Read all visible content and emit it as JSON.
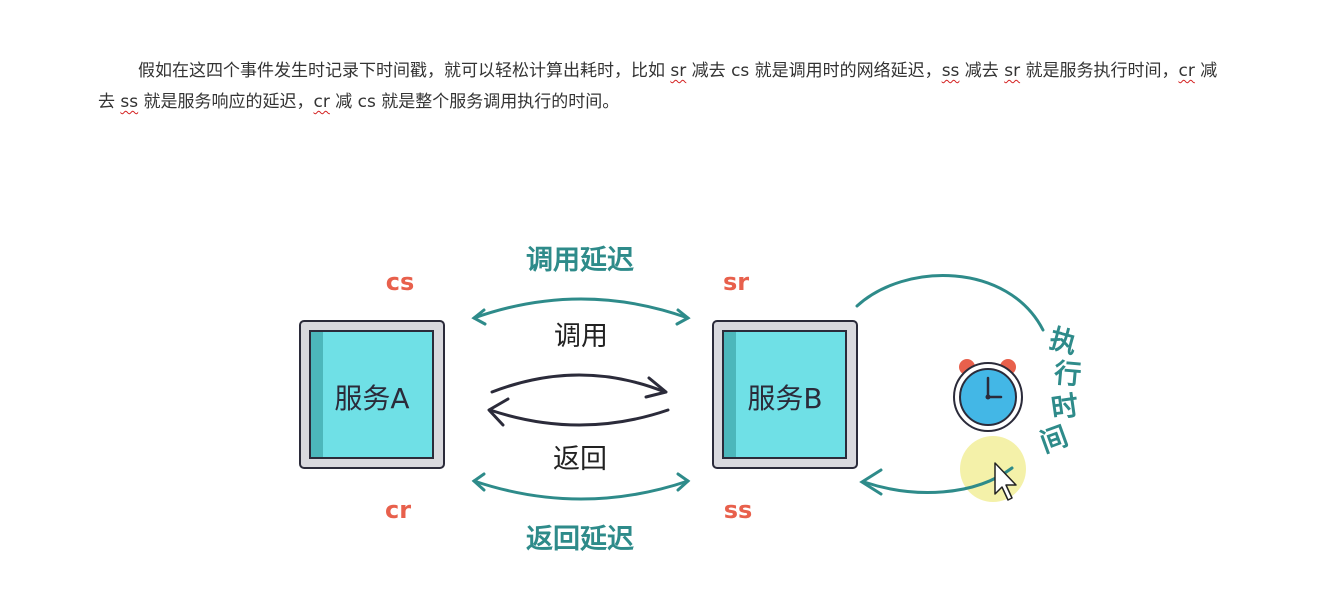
{
  "paragraph": {
    "p1": "假如在这四个事件发生时记录下时间戳，就可以轻松计算出耗时，比如 ",
    "sr1": "sr",
    "p2": " 减去 cs 就是调用时的网络延迟，",
    "ss1": "ss",
    "p3": " 减去 ",
    "sr2": "sr",
    "p4": " 就是服务执行时间，",
    "cr1": "cr",
    "p5": " 减去 ",
    "ss2": "ss",
    "p6": " 就是服务响应的延迟，",
    "cr2": "cr",
    "p7": " 减 cs 就是整个服务调用执行的时间。"
  },
  "diagram": {
    "service_a": "服务A",
    "service_b": "服务B",
    "event_cs": "cs",
    "event_sr": "sr",
    "event_cr": "cr",
    "event_ss": "ss",
    "call_latency": "调用延迟",
    "call": "调用",
    "return": "返回",
    "return_latency": "返回延迟",
    "exec_time": [
      "执",
      "行",
      "时",
      "间"
    ]
  },
  "colors": {
    "teal": "#2e8b8a",
    "red_label": "#e8604c",
    "box_fill": "#6fe0e6",
    "box_shade": "#4cb7bb",
    "box_frame": "#d9d9de",
    "clock_face": "#43b7e6",
    "bell": "#e8604c",
    "cursor_highlight": "#f2ee9a"
  }
}
